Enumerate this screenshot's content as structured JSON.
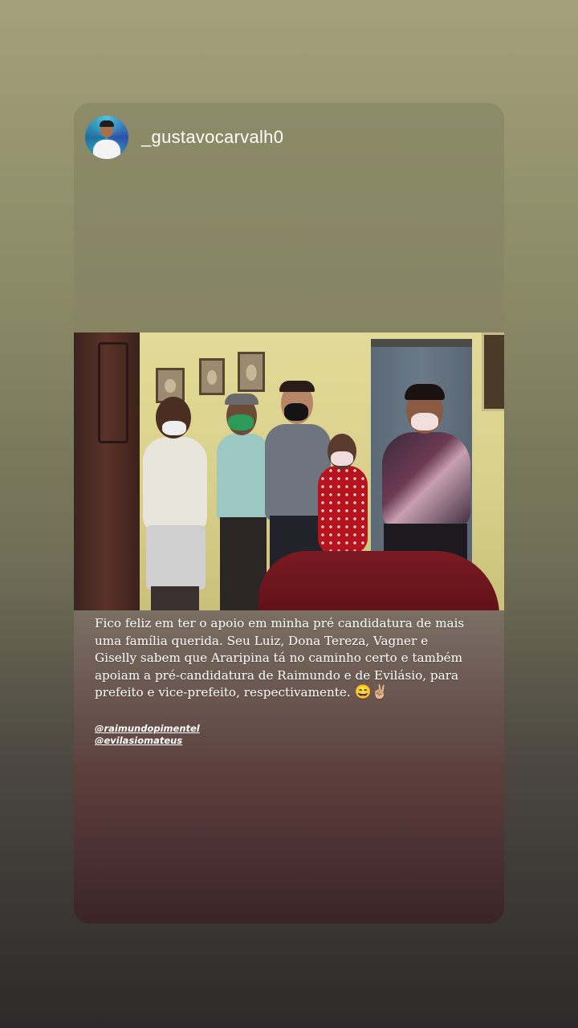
{
  "story": {
    "username": "_gustavocarvalh0",
    "caption": "Fico feliz em ter o apoio em minha pré candidatura de mais uma família querida. Seu Luiz, Dona Tereza, Vagner e Giselly sabem que Araripina tá no caminho certo e também apoiam a pré-candidatura de Raimundo e de Evilásio, para prefeito e vice-prefeito, respectivamente.",
    "caption_emojis": "😄✌🏼",
    "mentions": [
      "@raimundopimentel",
      "@evilasiomateus"
    ]
  },
  "colors": {
    "background_top": "#a3a07a",
    "background_bottom": "#2c2a2a",
    "card_top": "#8d8a68",
    "card_bottom": "#3c2326",
    "text": "#ffffff"
  },
  "icons": {
    "avatar": "profile-avatar",
    "photo": "group-photo"
  }
}
